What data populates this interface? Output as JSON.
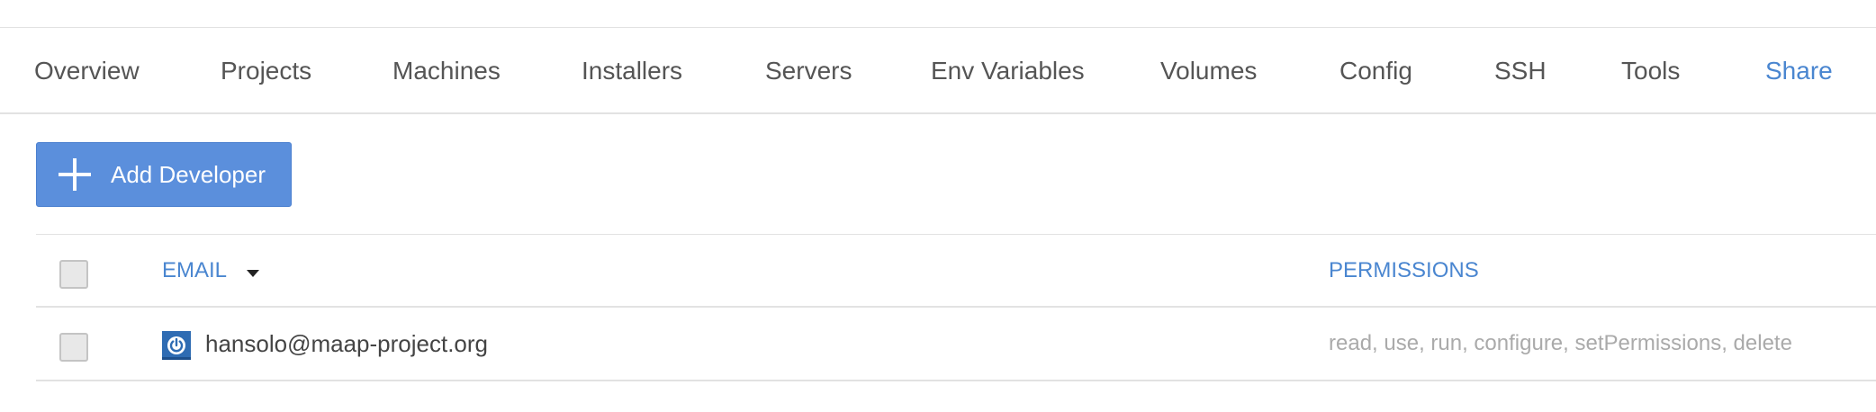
{
  "tabs": [
    {
      "label": "Overview"
    },
    {
      "label": "Projects"
    },
    {
      "label": "Machines"
    },
    {
      "label": "Installers"
    },
    {
      "label": "Servers"
    },
    {
      "label": "Env Variables"
    },
    {
      "label": "Volumes"
    },
    {
      "label": "Config"
    },
    {
      "label": "SSH"
    },
    {
      "label": "Tools"
    },
    {
      "label": "Share"
    }
  ],
  "active_tab": "Share",
  "toolbar": {
    "add_button_label": "Add Developer",
    "add_button_icon": "plus-icon"
  },
  "table": {
    "columns": {
      "email": "EMAIL",
      "permissions": "PERMISSIONS"
    },
    "sort": {
      "column": "EMAIL",
      "direction": "descending",
      "icon": "caret-down-icon"
    },
    "rows": [
      {
        "avatar_icon": "power-icon",
        "email": "hansolo@maap-project.org",
        "permissions": "read, use, run, configure, setPermissions, delete",
        "selected": false
      }
    ],
    "header_selected": false
  },
  "colors": {
    "accent": "#4a86d0",
    "button_bg": "#5b8fdc",
    "avatar_bg": "#2f6cb3",
    "text": "#555555",
    "muted_text": "#aaaaaa",
    "divider": "#e2e2e2"
  }
}
